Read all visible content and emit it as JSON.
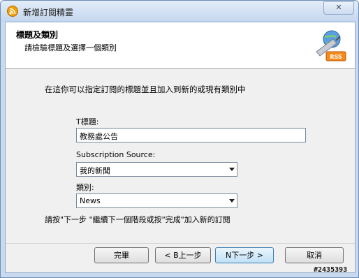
{
  "window": {
    "title": "新增訂閱精靈",
    "close_label": "✕"
  },
  "header": {
    "title": "標題及類別",
    "subtitle": "請檢驗標題及選擇一個類別",
    "badge_text": "RSS"
  },
  "body": {
    "intro": "在這你可以指定訂閱的標題並且加入到新的或現有類別中",
    "title_label": "T標題:",
    "title_value": "教務處公告",
    "source_label": "Subscription Source:",
    "source_value": "我的新聞",
    "category_label": "類別:",
    "category_value": "News",
    "instruction": "請按\"下一步 \"繼續下一個階段或按\"完成\"加入新的訂閱"
  },
  "buttons": {
    "finish": "完畢",
    "back": "< B上一步",
    "next": "N下一步 >",
    "cancel": "取消"
  },
  "watermark": "#2435393",
  "icons": {
    "app": "rss-feed-icon",
    "header_art": "rss-globe-icon"
  }
}
